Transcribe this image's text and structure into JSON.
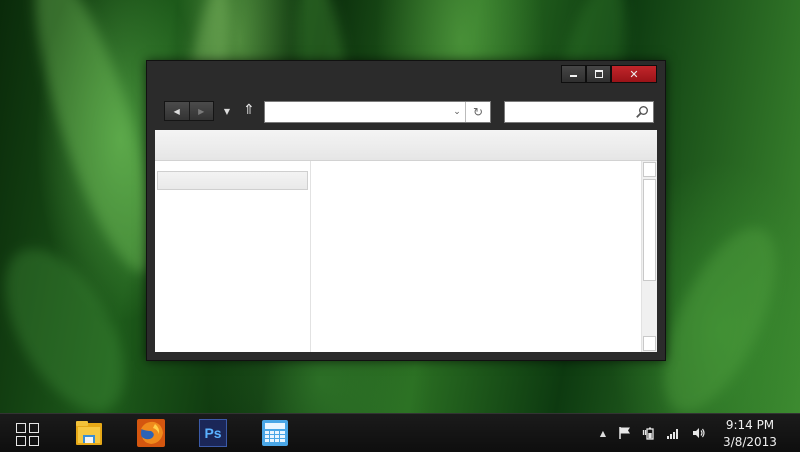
{
  "window": {
    "caption_buttons": {
      "minimize_icon": "minimize-icon",
      "maximize_icon": "maximize-icon",
      "close_symbol": "✕"
    },
    "navbar": {
      "back_symbol": "◀",
      "forward_symbol": "▶",
      "recent_symbol": "▼",
      "up_symbol": "⇑",
      "address_value": "",
      "address_dropdown_symbol": "⌄",
      "refresh_symbol": "↻",
      "search_value": ""
    }
  },
  "taskbar": {
    "apps": [
      {
        "name": "File Explorer",
        "icon": "folder-icon"
      },
      {
        "name": "Firefox",
        "icon": "firefox-icon"
      },
      {
        "name": "Photoshop",
        "icon": "photoshop-icon",
        "label": "Ps"
      },
      {
        "name": "Calculator",
        "icon": "calculator-icon"
      }
    ],
    "tray": {
      "show_hidden_symbol": "▲"
    },
    "clock": {
      "time": "9:14 PM",
      "date": "3/8/2013"
    }
  },
  "colors": {
    "close_button": "#b01c21",
    "window_frame": "#2b2b2b",
    "taskbar": "#141414",
    "photoshop_bg": "#1a2a5a",
    "photoshop_text": "#4fa8ff"
  }
}
